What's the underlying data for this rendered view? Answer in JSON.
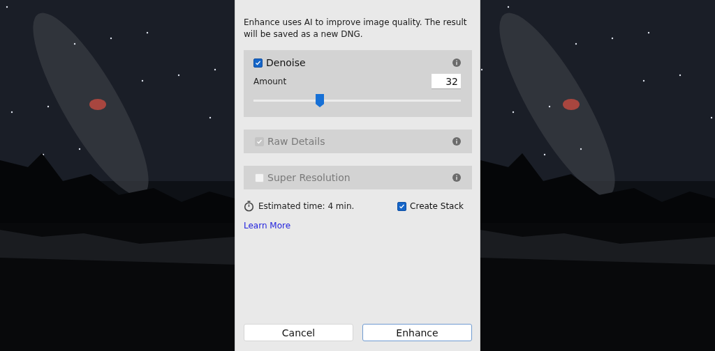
{
  "dialog": {
    "description": "Enhance uses AI to improve image quality. The result will be saved as a new DNG.",
    "options": [
      {
        "kind": "slider",
        "label": "Denoise",
        "checked": true,
        "disabled": false,
        "amount_label": "Amount",
        "amount_value": "32",
        "level": 0.32
      },
      {
        "kind": "plain",
        "label": "Raw Details",
        "checked": true,
        "disabled": true
      },
      {
        "kind": "plain",
        "label": "Super Resolution",
        "checked": false,
        "disabled": true
      }
    ],
    "estimated_time": "Estimated time: 4 min.",
    "create_stack": {
      "label": "Create Stack",
      "checked": true
    },
    "learn_more": "Learn More",
    "buttons": [
      {
        "label": "Cancel",
        "primary": false
      },
      {
        "label": "Enhance",
        "primary": true
      }
    ]
  }
}
